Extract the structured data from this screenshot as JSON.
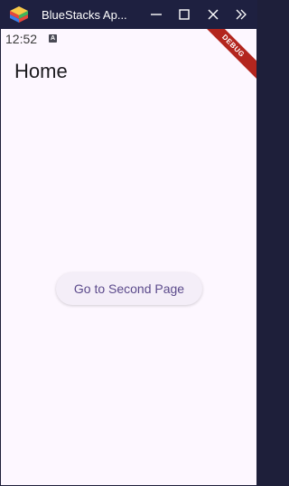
{
  "window": {
    "title": "BlueStacks Ap...",
    "accent_color": "#1e2040"
  },
  "status_bar": {
    "time": "12:52",
    "notification_icon": "A"
  },
  "debug_banner": {
    "label": "DEBUG",
    "color": "#b3261e"
  },
  "page": {
    "title": "Home",
    "background": "#fdf7ff"
  },
  "main": {
    "button_label": "Go to Second Page",
    "button_text_color": "#5b4a8b"
  },
  "icons": {
    "logo": "bluestacks-logo-icon",
    "minimize": "minimize-icon",
    "maximize": "maximize-icon",
    "close": "close-icon",
    "sidebar": "double-chevron-right-icon"
  }
}
